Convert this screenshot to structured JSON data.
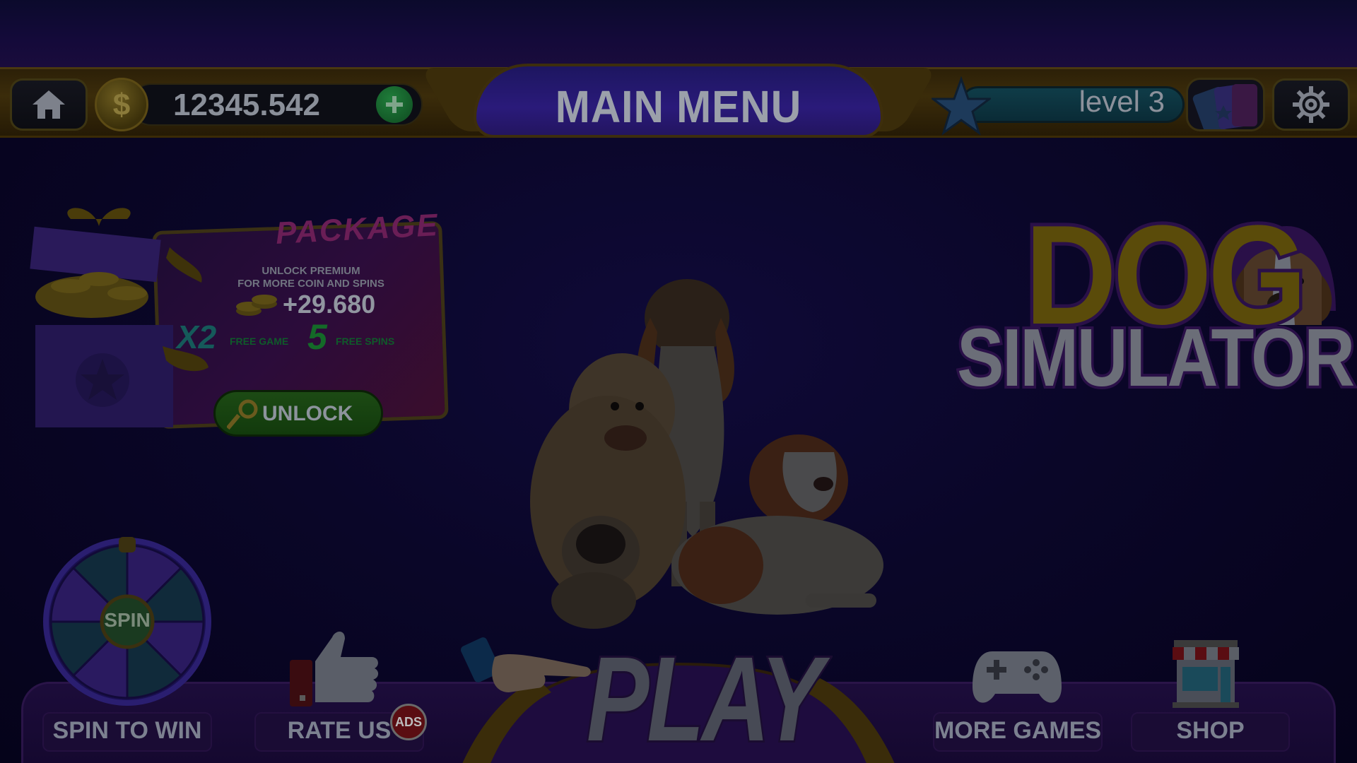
{
  "topbar": {
    "coin_value": "12345.542",
    "title": "MAIN MENU",
    "level": "level 3"
  },
  "package": {
    "title": "PACKAGE",
    "line1": "UNLOCK PREMIUM",
    "line2": "FOR MORE COIN AND SPINS",
    "amount": "+29.680",
    "multiplier": "X2",
    "free_game": "FREE GAME",
    "spins_count": "5",
    "free_spins": "FREE SPINS",
    "unlock_label": "UNLOCK"
  },
  "logo": {
    "line1": "DOG",
    "line2": "SIMULATOR"
  },
  "bottom": {
    "spin_wheel_center": "SPIN",
    "spin_label": "SPIN TO WIN",
    "rate_label": "RATE US",
    "ads_badge": "ADS",
    "play_label": "PLAY",
    "more_games_label": "MORE GAMES",
    "shop_label": "SHOP"
  },
  "icons": {
    "home": "home-icon",
    "coin": "dollar-coin-icon",
    "add": "plus-icon",
    "level": "star-icon",
    "cards": "cards-icon",
    "settings": "gear-icon",
    "key": "key-icon",
    "thumb": "thumbs-up-icon",
    "gamepad": "gamepad-icon",
    "shop": "storefront-icon",
    "hand": "pointing-hand-icon"
  },
  "colors": {
    "background": "#0a0628",
    "topbar_gold": "#3b2c0a",
    "title_purple": "#2a1a7a",
    "level_teal": "#0f3c48",
    "unlock_green": "#1c4a14",
    "ads_red": "#5a0d12"
  }
}
